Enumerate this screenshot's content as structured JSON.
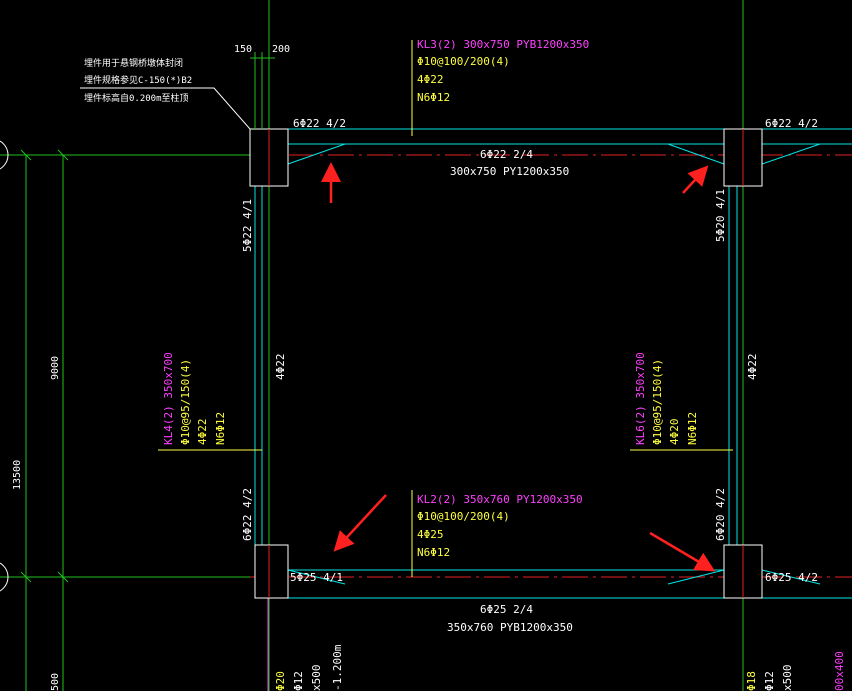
{
  "colors": {
    "background": "#000000",
    "beam": "#00e5e5",
    "axis": "#e02020",
    "dim": "#20c020",
    "magenta": "#ff40ff",
    "yellow": "#ffff40",
    "white": "#ffffff",
    "arrow": "#ff2020"
  },
  "dimensions": {
    "d150": "150",
    "d200": "200",
    "d9000": "9000",
    "d13500": "13500",
    "d500": "500"
  },
  "embed_note": {
    "line1": "埋件用于悬钢桥墩体封闭",
    "line2": "埋件规格参见C-150(*)B2",
    "line3": "埋件标高自0.200m至柱顶"
  },
  "beam_kl3": {
    "name": "KL3(2) 300x750 PYB1200x350",
    "stirrup": "Φ10@100/200(4)",
    "top": "4Φ22",
    "side": "N6Φ12",
    "left_support": "6Φ22 4/2",
    "right_support": "6Φ22 4/2",
    "bottom": "6Φ22 2/4",
    "section": "300x750 PY1200x350"
  },
  "beam_kl2": {
    "name": "KL2(2) 350x760 PY1200x350",
    "stirrup": "Φ10@100/200(4)",
    "top": "4Φ25",
    "side": "N6Φ12",
    "left_support": "5Φ25 4/1",
    "right_support": "6Φ25 4/2",
    "bottom": "6Φ25 2/4",
    "section": "350x760 PYB1200x350"
  },
  "beam_kl4": {
    "name": "KL4(2) 350x700",
    "stirrup": "Φ10@95/150(4)",
    "top": "4Φ22",
    "side": "N6Φ12",
    "upper_support": "5Φ22 4/1",
    "lower_support": "6Φ22 4/2",
    "bottom": "4Φ22"
  },
  "beam_kl6": {
    "name": "KL6(2) 350x700",
    "stirrup": "Φ10@95/150(4)",
    "top": "4Φ20",
    "side": "N6Φ12",
    "upper_support": "5Φ20 4/1",
    "lower_support": "6Φ20 4/2",
    "bottom": "4Φ22"
  },
  "bottom_cut": {
    "a1": "Φ20",
    "a2": "Φ12",
    "a3": "x500",
    "a4": "-1.200m",
    "b1": "Φ18",
    "b2": "Φ12",
    "b3": "x500",
    "b4": "00x400"
  },
  "annotations": [
    {
      "name": "arrow-top-left"
    },
    {
      "name": "arrow-top-right"
    },
    {
      "name": "arrow-bottom-left"
    },
    {
      "name": "arrow-bottom-right"
    }
  ]
}
